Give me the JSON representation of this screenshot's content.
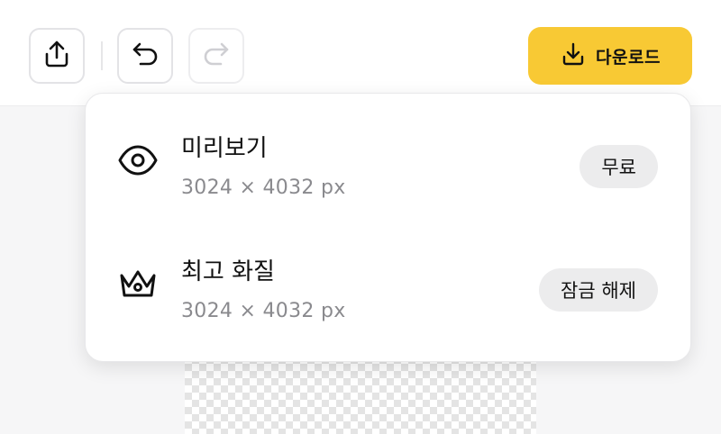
{
  "toolbar": {
    "share_icon": "share-upload-icon",
    "undo_icon": "undo-icon",
    "redo_icon": "redo-icon",
    "download_label": "다운로드",
    "download_icon": "download-icon",
    "accent_color": "#f8c934"
  },
  "download_menu": {
    "options": [
      {
        "icon": "eye-icon",
        "title": "미리보기",
        "resolution": "3024 × 4032 px",
        "action_label": "무료"
      },
      {
        "icon": "crown-icon",
        "title": "최고 화질",
        "resolution": "3024 × 4032 px",
        "action_label": "잠금 해제"
      }
    ]
  }
}
